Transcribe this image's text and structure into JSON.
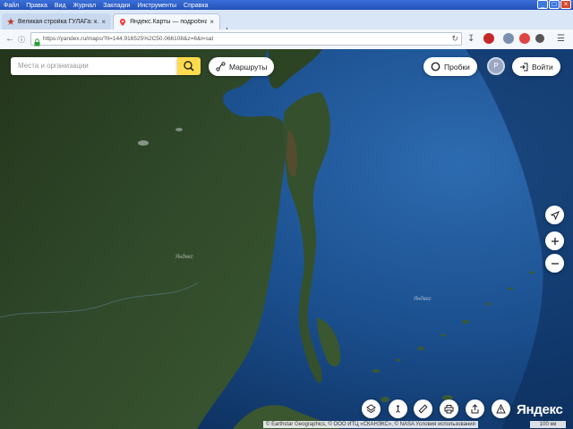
{
  "browser": {
    "menu": [
      "Файл",
      "Правка",
      "Вид",
      "Журнал",
      "Закладки",
      "Инструменты",
      "Справка"
    ],
    "tabs": [
      {
        "label": "Великая стройка ГУЛАГа: к…",
        "close": "×",
        "active": false
      },
      {
        "label": "Яндекс.Карты — подробна…",
        "close": "×",
        "active": true
      }
    ],
    "newtab": "+",
    "url": "https://yandex.ru/maps/?ll=144.916525%2C50.066108&z=6&l=sat",
    "window_buttons": [
      "_",
      "□",
      "×"
    ]
  },
  "map": {
    "search_placeholder": "Места и организации",
    "routes_label": "Маршруты",
    "traffic_label": "Пробки",
    "parking_label": "P",
    "login_label": "Войти",
    "watermark": "Яндекс",
    "logo": "Яндекс",
    "copyright": "© Earthstar Geographics, © ООО ИТЦ «СКАНЭКС», © NASA Условия использования",
    "scale": "100 км",
    "colors": {
      "search_button": "#ffdb4d",
      "land": "#2f4a22",
      "sea": "#1a4f8a"
    }
  }
}
